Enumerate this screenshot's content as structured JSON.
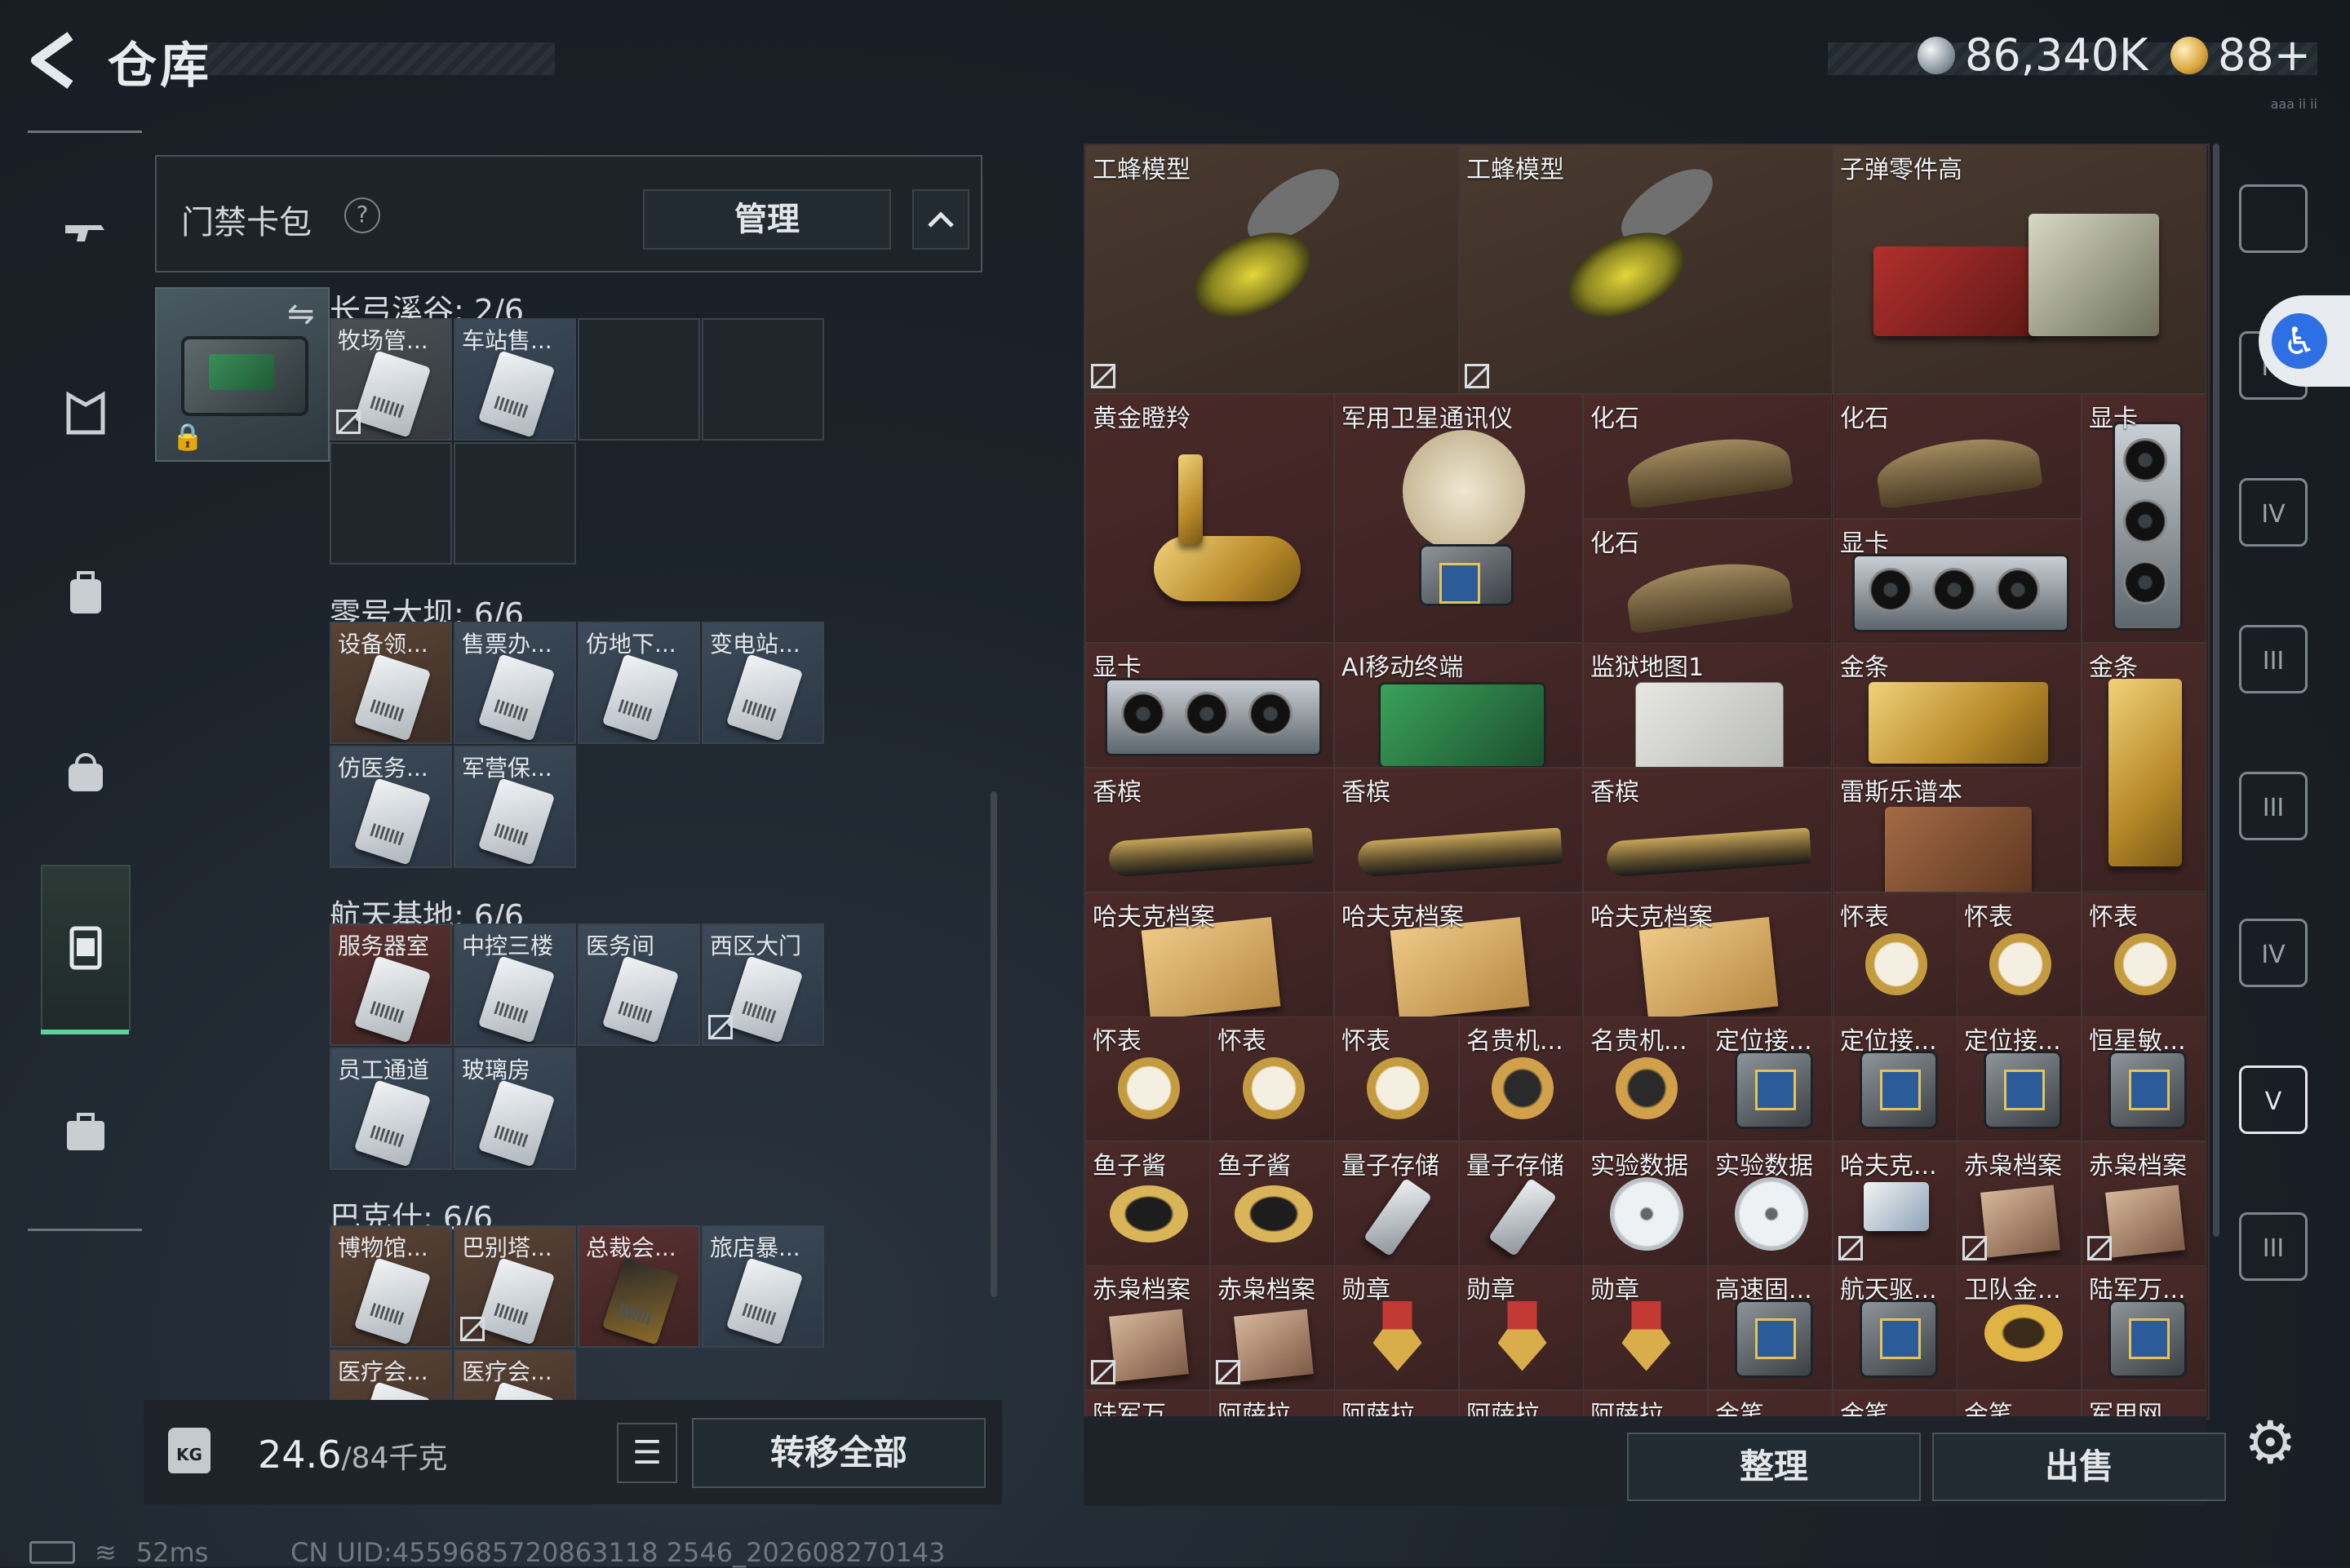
{
  "header": {
    "title": "仓库",
    "currency_silver": "86,340K",
    "currency_gold": "88+",
    "tiny_text": "aaa ii ii"
  },
  "left_panel": {
    "case_title": "门禁卡包",
    "help_label": "?",
    "manage_label": "管理",
    "groups": [
      {
        "title": "长弓溪谷: 2/6",
        "slots": [
          {
            "label": "牧场管...",
            "style": "gray",
            "locked": true
          },
          {
            "label": "车站售...",
            "style": "blue",
            "locked": false
          }
        ]
      },
      {
        "title": "零号大坝: 6/6",
        "slots": [
          {
            "label": "设备领...",
            "style": "brown",
            "locked": false
          },
          {
            "label": "售票办...",
            "style": "blue",
            "locked": false
          },
          {
            "label": "仿地下...",
            "style": "blue",
            "locked": false
          },
          {
            "label": "变电站...",
            "style": "blue",
            "locked": false
          },
          {
            "label": "仿医务...",
            "style": "blue",
            "locked": false
          },
          {
            "label": "军营保...",
            "style": "blue",
            "locked": false
          }
        ]
      },
      {
        "title": "航天基地: 6/6",
        "slots": [
          {
            "label": "服务器室",
            "style": "red",
            "locked": false
          },
          {
            "label": "中控三楼",
            "style": "blue",
            "locked": false
          },
          {
            "label": "医务间",
            "style": "blue",
            "locked": false
          },
          {
            "label": "西区大门",
            "style": "blue",
            "locked": true
          },
          {
            "label": "员工通道",
            "style": "blue",
            "locked": false
          },
          {
            "label": "玻璃房",
            "style": "blue",
            "locked": false
          }
        ]
      },
      {
        "title": "巴克什: 6/6",
        "slots": [
          {
            "label": "博物馆...",
            "style": "brown",
            "locked": false
          },
          {
            "label": "巴别塔...",
            "style": "brown",
            "locked": true
          },
          {
            "label": "总裁会...",
            "style": "red",
            "locked": false
          },
          {
            "label": "旅店暴...",
            "style": "blue",
            "locked": false
          },
          {
            "label": "医疗会...",
            "style": "brown",
            "locked": false
          },
          {
            "label": "医疗会...",
            "style": "brown",
            "locked": false
          }
        ]
      }
    ],
    "weight_icon_label": "KG",
    "weight_value": "24.6",
    "weight_max": "/84千克",
    "transfer_label": "转移全部"
  },
  "status": {
    "ping": "52ms",
    "uid": "CN UID:4559685720863118 2546_202608270143"
  },
  "inventory": {
    "items": [
      {
        "label": "工蜂模型",
        "type": "bee",
        "bg": "c-brown",
        "locked": true
      },
      {
        "label": "工蜂模型",
        "type": "bee",
        "bg": "c-brown",
        "locked": true
      },
      {
        "label": "子弹零件高",
        "type": "ammo",
        "bg": "c-brown",
        "locked": false
      },
      {
        "label": "黄金瞪羚",
        "type": "deer",
        "bg": "c-red",
        "locked": false
      },
      {
        "label": "军用卫星通讯仪",
        "type": "dish",
        "bg": "c-red",
        "locked": false
      },
      {
        "label": "化石",
        "type": "claw",
        "bg": "c-red",
        "locked": false
      },
      {
        "label": "化石",
        "type": "claw",
        "bg": "c-red",
        "locked": false
      },
      {
        "label": "显卡",
        "type": "gpu-v",
        "bg": "c-red",
        "locked": false
      },
      {
        "label": "化石",
        "type": "claw",
        "bg": "c-red",
        "locked": false
      },
      {
        "label": "显卡",
        "type": "gpu",
        "bg": "c-red",
        "locked": false
      },
      {
        "label": "显卡",
        "type": "gpu",
        "bg": "c-red",
        "locked": false
      },
      {
        "label": "AI移动终端",
        "type": "tablet",
        "bg": "c-red",
        "locked": false
      },
      {
        "label": "监狱地图1",
        "type": "map",
        "bg": "c-red",
        "locked": false
      },
      {
        "label": "金条",
        "type": "gold-h",
        "bg": "c-red",
        "locked": false
      },
      {
        "label": "金条",
        "type": "gold-v",
        "bg": "c-red",
        "locked": false
      },
      {
        "label": "香槟",
        "type": "bottle",
        "bg": "c-red",
        "locked": false
      },
      {
        "label": "香槟",
        "type": "bottle",
        "bg": "c-red",
        "locked": false
      },
      {
        "label": "香槟",
        "type": "bottle",
        "bg": "c-red",
        "locked": false
      },
      {
        "label": "雷斯乐谱本",
        "type": "book",
        "bg": "c-red",
        "locked": false
      },
      {
        "label": "哈夫克档案",
        "type": "folder",
        "bg": "c-red",
        "locked": false
      },
      {
        "label": "哈夫克档案",
        "type": "folder",
        "bg": "c-red",
        "locked": false
      },
      {
        "label": "哈夫克档案",
        "type": "folder",
        "bg": "c-red",
        "locked": false
      },
      {
        "label": "怀表",
        "type": "watch",
        "bg": "c-red",
        "locked": false
      },
      {
        "label": "怀表",
        "type": "watch",
        "bg": "c-red",
        "locked": false
      },
      {
        "label": "怀表",
        "type": "watch",
        "bg": "c-red",
        "locked": false
      },
      {
        "label": "怀表",
        "type": "watch",
        "bg": "c-red",
        "locked": false
      },
      {
        "label": "怀表",
        "type": "watch",
        "bg": "c-red",
        "locked": false
      },
      {
        "label": "怀表",
        "type": "watch",
        "bg": "c-red",
        "locked": false
      },
      {
        "label": "名贵机...",
        "type": "rolex",
        "bg": "c-red",
        "locked": false
      },
      {
        "label": "名贵机...",
        "type": "rolex",
        "bg": "c-red",
        "locked": false
      },
      {
        "label": "定位接...",
        "type": "device",
        "bg": "c-red",
        "locked": false
      },
      {
        "label": "定位接...",
        "type": "device",
        "bg": "c-red",
        "locked": false
      },
      {
        "label": "定位接...",
        "type": "device",
        "bg": "c-red",
        "locked": false
      },
      {
        "label": "恒星敏...",
        "type": "device",
        "bg": "c-red",
        "locked": false
      },
      {
        "label": "鱼子酱",
        "type": "caviar",
        "bg": "c-red",
        "locked": false
      },
      {
        "label": "鱼子酱",
        "type": "caviar",
        "bg": "c-red",
        "locked": false
      },
      {
        "label": "量子存储",
        "type": "usb",
        "bg": "c-red",
        "locked": false
      },
      {
        "label": "量子存储",
        "type": "usb",
        "bg": "c-red",
        "locked": false
      },
      {
        "label": "实验数据",
        "type": "disc",
        "bg": "c-red",
        "locked": false
      },
      {
        "label": "实验数据",
        "type": "disc",
        "bg": "c-red",
        "locked": false
      },
      {
        "label": "哈夫克...",
        "type": "card",
        "bg": "c-red",
        "locked": true
      },
      {
        "label": "赤枭档案",
        "type": "folder",
        "bg": "c-red",
        "locked": true
      },
      {
        "label": "赤枭档案",
        "type": "folder",
        "bg": "c-red",
        "locked": true
      },
      {
        "label": "赤枭档案",
        "type": "folder",
        "bg": "c-red",
        "locked": true
      },
      {
        "label": "赤枭档案",
        "type": "folder",
        "bg": "c-red",
        "locked": true
      },
      {
        "label": "勋章",
        "type": "medal",
        "bg": "c-red",
        "locked": false
      },
      {
        "label": "勋章",
        "type": "medal",
        "bg": "c-red",
        "locked": false
      },
      {
        "label": "勋章",
        "type": "medal",
        "bg": "c-red",
        "locked": false
      },
      {
        "label": "高速固...",
        "type": "device",
        "bg": "c-red",
        "locked": false
      },
      {
        "label": "航天驱...",
        "type": "device",
        "bg": "c-red",
        "locked": false
      },
      {
        "label": "卫队金...",
        "type": "ring",
        "bg": "c-red",
        "locked": false
      },
      {
        "label": "陆军万...",
        "type": "device",
        "bg": "c-red",
        "locked": false
      },
      {
        "label": "陆军万...",
        "type": "none",
        "bg": "c-red",
        "locked": false
      },
      {
        "label": "阿萨拉...",
        "type": "none",
        "bg": "c-red",
        "locked": false
      },
      {
        "label": "阿萨拉...",
        "type": "none",
        "bg": "c-red",
        "locked": false
      },
      {
        "label": "阿萨拉...",
        "type": "none",
        "bg": "c-red",
        "locked": false
      },
      {
        "label": "阿萨拉...",
        "type": "none",
        "bg": "c-red",
        "locked": false
      },
      {
        "label": "金笔",
        "type": "none",
        "bg": "c-red",
        "locked": false
      },
      {
        "label": "金笔",
        "type": "none",
        "bg": "c-red",
        "locked": false
      },
      {
        "label": "金笔",
        "type": "none",
        "bg": "c-red",
        "locked": false
      },
      {
        "label": "军用网...",
        "type": "none",
        "bg": "c-red",
        "locked": false
      }
    ],
    "sort_label": "整理",
    "sell_label": "出售"
  },
  "right_tabs": [
    {
      "label": "",
      "icon": "home-icon"
    },
    {
      "label": "IV",
      "icon": "storage-iv-icon"
    },
    {
      "label": "IV",
      "icon": "storage-iv-plus-icon"
    },
    {
      "label": "III",
      "icon": "storage-iii-icon"
    },
    {
      "label": "III",
      "icon": "storage-iii-b-icon"
    },
    {
      "label": "IV",
      "icon": "storage-iv-b-icon"
    },
    {
      "label": "V",
      "icon": "storage-v-icon"
    },
    {
      "label": "III",
      "icon": "storage-iii-c-icon"
    }
  ]
}
